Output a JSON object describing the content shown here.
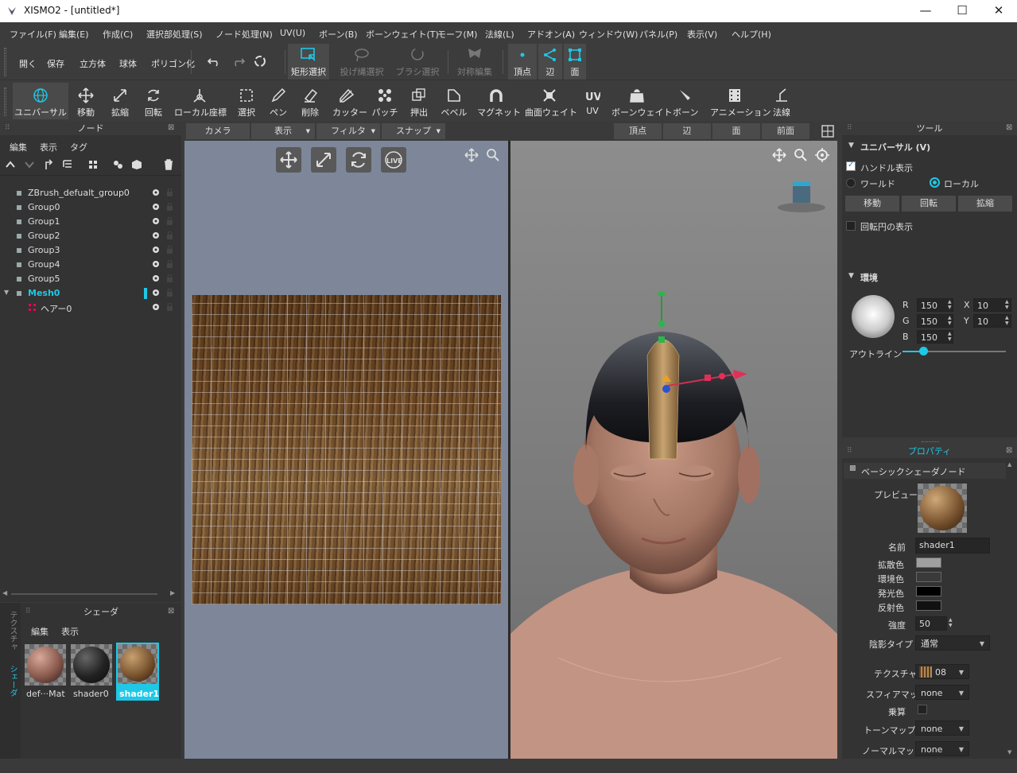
{
  "window": {
    "title": "XISMO2 - [untitled*]",
    "controls": [
      "—",
      "☐",
      "✕"
    ]
  },
  "menu": [
    "ファイル(F)",
    "編集(E)",
    "作成(C)",
    "選択部処理(S)",
    "ノード処理(N)",
    "UV(U)",
    "ボーン(B)",
    "ボーンウェイト(T)",
    "モーフ(M)",
    "法線(L)",
    "アドオン(A)",
    "ウィンドウ(W)",
    "パネル(P)",
    "表示(V)",
    "ヘルプ(H)"
  ],
  "toolbar1": {
    "file": [
      "開く",
      "保存",
      "立方体",
      "球体",
      "ポリゴン化"
    ],
    "select_modes": [
      "矩形選択",
      "投げ縄選択",
      "ブラシ選択"
    ],
    "symmetry": "対称編集",
    "elements": [
      "頂点",
      "辺",
      "面"
    ]
  },
  "toolbar2": {
    "tools": [
      "ユニバーサル",
      "移動",
      "拡縮",
      "回転",
      "ローカル座標",
      "選択",
      "ペン",
      "削除",
      "カッター",
      "パッチ",
      "押出",
      "ベベル",
      "マグネット",
      "曲面ウェイト",
      "UV",
      "ボーンウェイト",
      "ボーン",
      "アニメーション",
      "法線"
    ]
  },
  "node_panel": {
    "title": "ノード",
    "menu": [
      "編集",
      "表示",
      "タグ"
    ],
    "items": [
      {
        "name": "ZBrush_defualt_group0"
      },
      {
        "name": "Group0"
      },
      {
        "name": "Group1"
      },
      {
        "name": "Group2"
      },
      {
        "name": "Group3"
      },
      {
        "name": "Group4"
      },
      {
        "name": "Group5"
      },
      {
        "name": "Mesh0"
      },
      {
        "name": "ヘアー0"
      }
    ]
  },
  "shader_panel": {
    "title": "シェーダ",
    "menu": [
      "編集",
      "表示"
    ],
    "side_tabs": [
      "テクスチャ",
      "シェーダ"
    ],
    "items": [
      "def···Mat",
      "shader0",
      "shader1"
    ]
  },
  "viewport_bar": {
    "left": [
      "カメラ",
      "表示",
      "フィルタ",
      "スナップ"
    ],
    "right": [
      "頂点",
      "辺",
      "面",
      "前面"
    ]
  },
  "tool_panel": {
    "title": "ツール",
    "section": "ユニバーサル (V)",
    "handle_display": "ハンドル表示",
    "world": "ワールド",
    "local": "ローカル",
    "buttons": [
      "移動",
      "回転",
      "拡縮"
    ],
    "rotation_circle": "回転円の表示",
    "env_section": "環境",
    "rgb": {
      "R": "150",
      "G": "150",
      "B": "150"
    },
    "xy": {
      "X": "10",
      "Y": "10"
    },
    "outline": "アウトライン",
    "outline_value": 0.2
  },
  "property_panel": {
    "title": "プロパティ",
    "node_type": "ベーシックシェーダノード",
    "preview_label": "プレビュー",
    "name_label": "名前",
    "name_value": "shader1",
    "diffuse": "拡散色",
    "ambient": "環境色",
    "emissive": "発光色",
    "specular": "反射色",
    "strength_label": "強度",
    "strength_value": "50",
    "shading_label": "陰影タイプ",
    "shading_value": "通常",
    "texture_label": "テクスチャ",
    "texture_value": "08",
    "sphere_label": "スフィアマップ",
    "sphere_value": "none",
    "multiply_label": "乗算",
    "toon_label": "トーンマップ",
    "toon_value": "none",
    "normal_label": "ノーマルマップ",
    "normal_value": "none"
  },
  "colors": {
    "accent": "#1ec8e6",
    "diffuse": "#a0a0a0",
    "ambient": "#3a3a3a",
    "emissive": "#000000",
    "specular": "#111111"
  }
}
